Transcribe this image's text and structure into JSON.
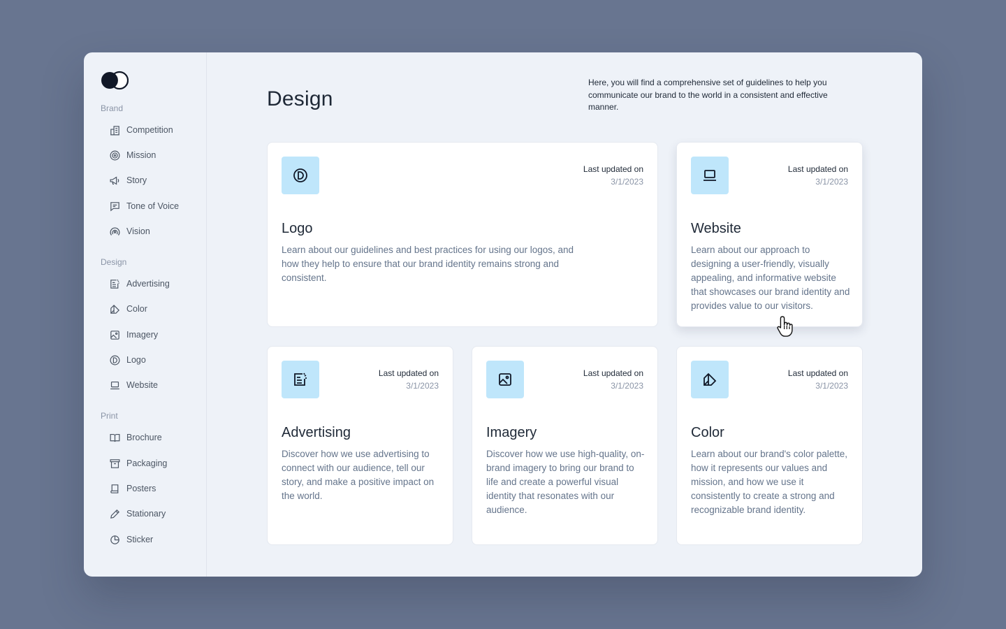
{
  "sidebar": {
    "sections": [
      {
        "label": "Brand",
        "items": [
          {
            "label": "Competition",
            "icon": "building-icon"
          },
          {
            "label": "Mission",
            "icon": "target-icon"
          },
          {
            "label": "Story",
            "icon": "megaphone-icon"
          },
          {
            "label": "Tone of Voice",
            "icon": "message-icon"
          },
          {
            "label": "Vision",
            "icon": "signal-icon"
          }
        ]
      },
      {
        "label": "Design",
        "items": [
          {
            "label": "Advertising",
            "icon": "ad-icon"
          },
          {
            "label": "Color",
            "icon": "color-swatch-icon"
          },
          {
            "label": "Imagery",
            "icon": "image-icon"
          },
          {
            "label": "Logo",
            "icon": "logo-d-icon"
          },
          {
            "label": "Website",
            "icon": "laptop-icon"
          }
        ]
      },
      {
        "label": "Print",
        "items": [
          {
            "label": "Brochure",
            "icon": "book-icon"
          },
          {
            "label": "Packaging",
            "icon": "archive-icon"
          },
          {
            "label": "Posters",
            "icon": "poster-icon"
          },
          {
            "label": "Stationary",
            "icon": "pencil-icon"
          },
          {
            "label": "Sticker",
            "icon": "sticker-icon"
          }
        ]
      }
    ]
  },
  "main": {
    "title": "Design",
    "intro": "Here, you will find a comprehensive set of guidelines to help you communicate our brand to the world in a consistent and effective manner.",
    "cards": [
      {
        "title": "Logo",
        "updated_label": "Last updated on",
        "updated_date": "3/1/2023",
        "icon": "logo-d-icon",
        "description": "Learn about our guidelines and best practices for using our logos, and how they help to ensure that our brand identity remains strong and consistent."
      },
      {
        "title": "Website",
        "updated_label": "Last updated on",
        "updated_date": "3/1/2023",
        "icon": "laptop-icon",
        "description": "Learn about our approach to designing a user-friendly, visually appealing, and informative website that showcases our brand identity and provides value to our visitors."
      },
      {
        "title": "Advertising",
        "updated_label": "Last updated on",
        "updated_date": "3/1/2023",
        "icon": "ad-icon",
        "description": "Discover how we use advertising to connect with our audience, tell our story, and make a positive impact on the world."
      },
      {
        "title": "Imagery",
        "updated_label": "Last updated on",
        "updated_date": "3/1/2023",
        "icon": "image-icon",
        "description": "Discover how we use high-quality, on-brand imagery to bring our brand to life and create a powerful visual identity that resonates with our audience."
      },
      {
        "title": "Color",
        "updated_label": "Last updated on",
        "updated_date": "3/1/2023",
        "icon": "color-swatch-icon",
        "description": "Learn about our brand's color palette, how it represents our values and mission, and how we use it consistently to create a strong and recognizable brand identity."
      }
    ]
  },
  "colors": {
    "background": "#687590",
    "window": "#eef2f8",
    "icon_tile": "#bfe6fb",
    "card": "#ffffff"
  }
}
